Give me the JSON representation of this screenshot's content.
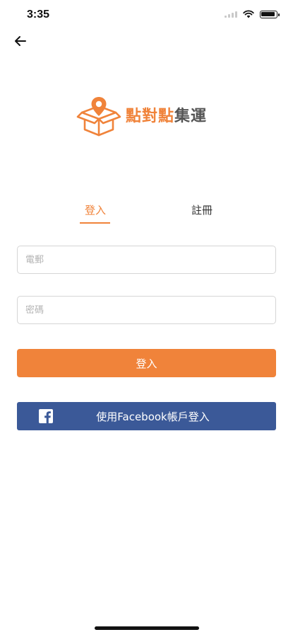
{
  "status_bar": {
    "time": "3:35"
  },
  "logo": {
    "text_accent": "點對點",
    "text_dark": "集運"
  },
  "tabs": [
    {
      "label": "登入",
      "active": true
    },
    {
      "label": "註冊",
      "active": false
    }
  ],
  "form": {
    "email_placeholder": "電郵",
    "password_placeholder": "密碼",
    "login_label": "登入",
    "facebook_label": "使用Facebook帳戶登入"
  },
  "colors": {
    "accent": "#f0833a",
    "facebook": "#3b5998"
  },
  "icons": {
    "back": "arrow-left-icon",
    "logo": "box-location-pin-icon",
    "facebook": "facebook-icon"
  }
}
